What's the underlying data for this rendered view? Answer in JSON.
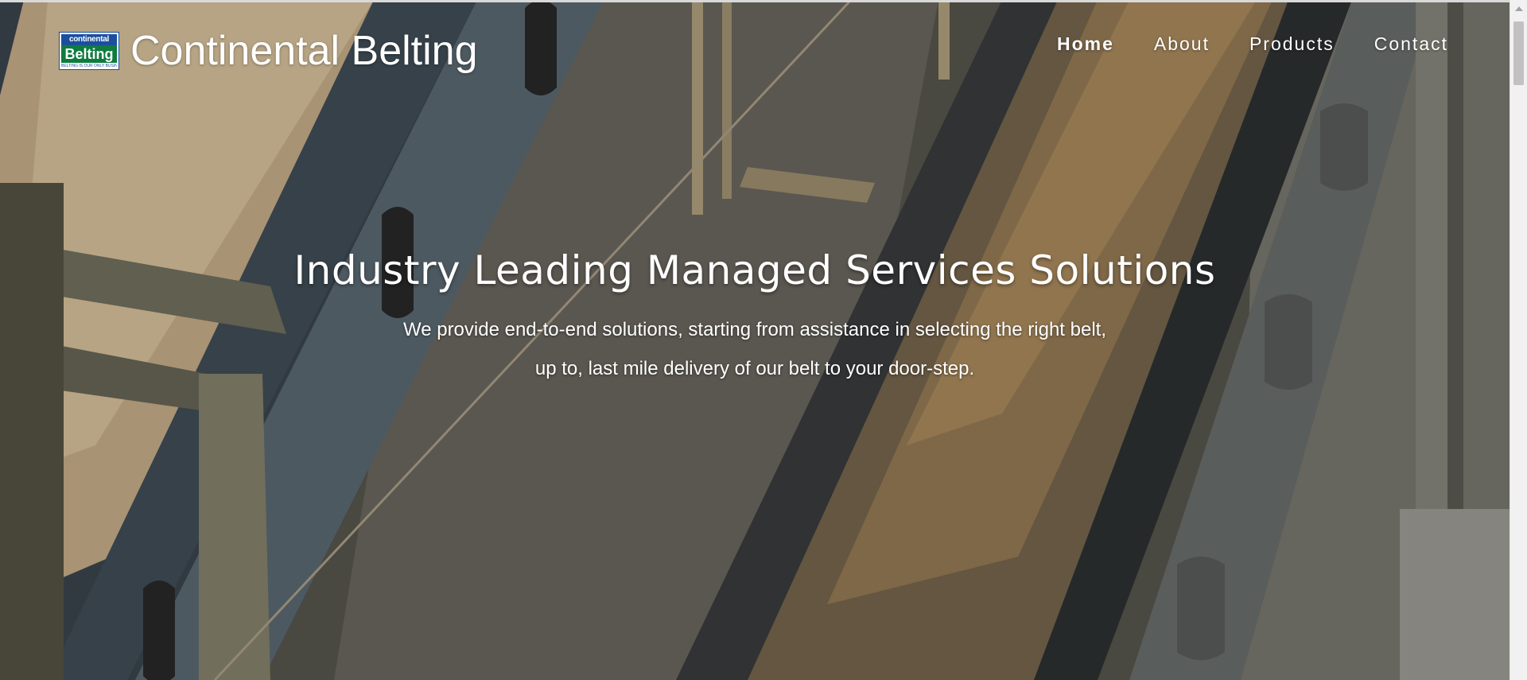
{
  "brand": {
    "logo_top": "continental",
    "logo_main": "Belting",
    "logo_tagline": "BELTING IS OUR ONLY BUSINESS",
    "name": "Continental Belting"
  },
  "nav": {
    "items": [
      {
        "label": "Home",
        "active": true
      },
      {
        "label": "About",
        "active": false
      },
      {
        "label": "Products",
        "active": false
      },
      {
        "label": "Contact",
        "active": false
      }
    ]
  },
  "hero": {
    "title": "Industry Leading Managed Services Solutions",
    "subtitle": "We provide end-to-end solutions, starting from assistance in selecting the right belt, up to, last mile delivery of our belt to your door-step."
  },
  "colors": {
    "logo_blue": "#1b4f9e",
    "logo_green": "#0f7b3e",
    "text": "#ffffff"
  }
}
